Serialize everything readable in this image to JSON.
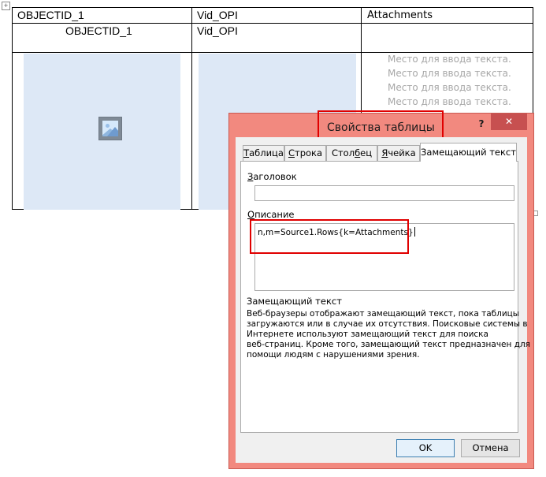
{
  "table": {
    "headers": [
      "OBJECTID_1",
      "Vid_OPI",
      "Attachments"
    ],
    "row1": [
      "OBJECTID_1",
      "Vid_OPI",
      ""
    ],
    "placeholders": [
      "Место для ввода текста.",
      "Место для ввода текста.",
      "Место для ввода текста.",
      "Место для ввода текста."
    ]
  },
  "dialog": {
    "title": "Свойства таблицы",
    "help": "?",
    "close": "✕",
    "tabs": [
      "Таблица",
      "Строка",
      "Столбец",
      "Ячейка",
      "Замещающий текст"
    ],
    "active_tab": "Замещающий текст",
    "title_label": "Заголовок",
    "title_value": "",
    "desc_label": "Описание",
    "desc_value": "n,m=Source1.Rows{k=Attachments}",
    "alt_heading": "Замещающий текст",
    "alt_help_lines": [
      "Веб-браузеры отображают замещающий текст, пока таблицы",
      "загружаются или в случае их отсутствия. Поисковые системы в",
      "Интернете используют замещающий текст для поиска",
      "веб-страниц. Кроме того, замещающий текст предназначен для",
      "помощи людям с нарушениями зрения."
    ],
    "ok": "OK",
    "cancel": "Отмена"
  },
  "colors": {
    "dialog_frame": "#f2897f",
    "highlight": "#e00000",
    "image_placeholder": "#dde8f6",
    "placeholder_text": "#a7a7a7"
  }
}
